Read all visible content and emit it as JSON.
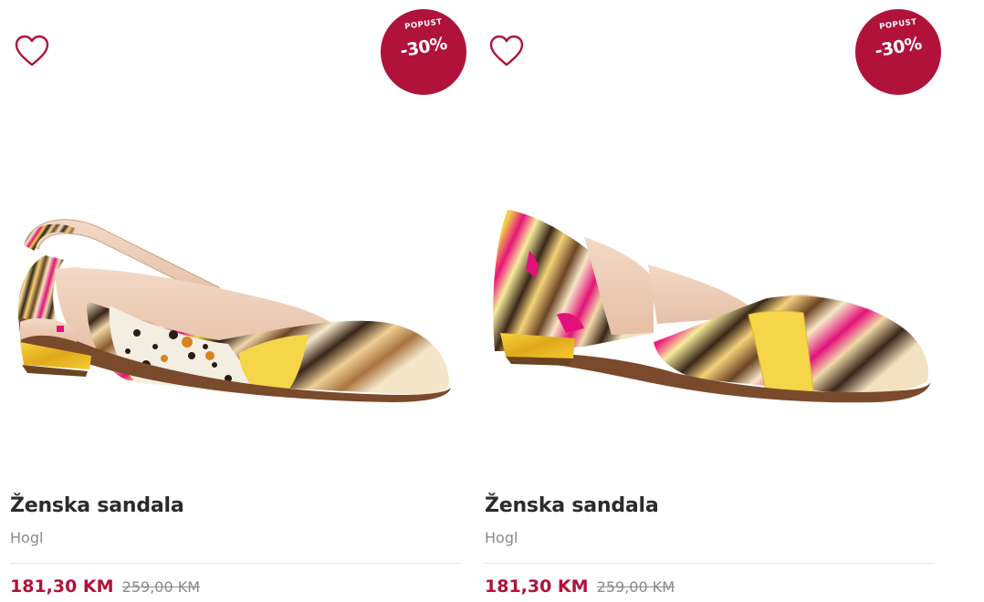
{
  "colors": {
    "accent": "#b0123a",
    "text": "#2b2b2b",
    "muted": "#8a8a8a",
    "divider": "#e4e4e4"
  },
  "products": [
    {
      "title": "Ženska sandala",
      "brand": "Hogl",
      "price": "181,30 KM",
      "old_price": "259,00 KM",
      "badge": {
        "label": "POPUST",
        "discount": "-30%"
      },
      "wishlist_icon": "heart-outline-icon"
    },
    {
      "title": "Ženska sandala",
      "brand": "Hogl",
      "price": "181,30 KM",
      "old_price": "259,00 KM",
      "badge": {
        "label": "POPUST",
        "discount": "-30%"
      },
      "wishlist_icon": "heart-outline-icon"
    }
  ]
}
